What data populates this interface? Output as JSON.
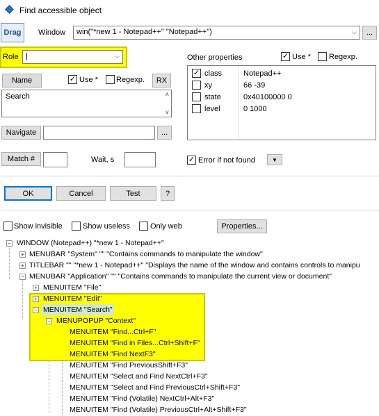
{
  "window": {
    "title": "Find accessible object",
    "icon": "diamond-icon"
  },
  "top": {
    "drag_label": "Drag",
    "window_label": "Window",
    "window_value": "win(\"*new 1 - Notepad++\" \"Notepad++\")",
    "window_browse": "..."
  },
  "role": {
    "label": "Role",
    "value": "|"
  },
  "name": {
    "tab_label": "Name",
    "use_label": "Use *",
    "regexp_label": "Regexp.",
    "rx_label": "RX",
    "value": "Search"
  },
  "other": {
    "title": "Other properties",
    "use_label": "Use *",
    "regexp_label": "Regexp.",
    "rows": [
      {
        "name": "class",
        "value": "Notepad++",
        "checked": "✓"
      },
      {
        "name": "xy",
        "value": "66 -39",
        "checked": ""
      },
      {
        "name": "state",
        "value": "0x40100000 0",
        "checked": ""
      },
      {
        "name": "level",
        "value": "0 1000",
        "checked": ""
      }
    ]
  },
  "navigate": {
    "label": "Navigate",
    "browse": "..."
  },
  "match": {
    "label": "Match #",
    "wait_label": "Wait, s",
    "error_label": "Error if not found"
  },
  "buttons": {
    "ok": "OK",
    "cancel": "Cancel",
    "test": "Test",
    "help": "?"
  },
  "options": {
    "show_invisible": "Show invisible",
    "show_useless": "Show useless",
    "only_web": "Only web",
    "properties": "Properties..."
  },
  "tree": [
    "WINDOW  (Notepad++)  \"*new 1 - Notepad++\"",
    "MENUBAR  \"System\"  \"\"  \"Contains commands to manipulate the window\"",
    "TITLEBAR  \"\"  \"*new 1 - Notepad++\"  \"Displays the name of the window and contains controls to manipu",
    "MENUBAR  \"Application\"  \"\"  \"Contains commands to manipulate the current view or document\"",
    "MENUITEM  \"File\"",
    "MENUITEM  \"Edit\"",
    "MENUITEM  \"Search\"",
    "MENUPOPUP  \"Context\"",
    "MENUITEM  \"Find...Ctrl+F\"",
    "MENUITEM  \"Find in Files...Ctrl+Shift+F\"",
    "MENUITEM  \"Find NextF3\"",
    "MENUITEM  \"Find PreviousShift+F3\"",
    "MENUITEM  \"Select and Find NextCtrl+F3\"",
    "MENUITEM  \"Select and Find PreviousCtrl+Shift+F3\"",
    "MENUITEM  \"Find (Volatile) NextCtrl+Alt+F3\"",
    "MENUITEM  \"Find (Volatile) PreviousCtrl+Alt+Shift+F3\""
  ],
  "colors": {
    "highlight": "#ffff00",
    "accent": "#0078d7"
  }
}
